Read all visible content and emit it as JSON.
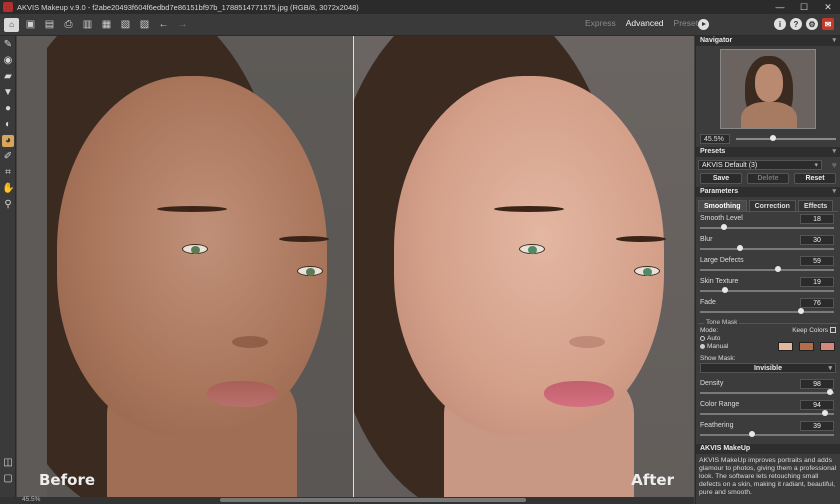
{
  "window": {
    "title": "AKVIS Makeup v.9.0 - f2abe20493f604f6edbd7e86151bf97b_1788514771575.jpg (RGB/8, 3072x2048)",
    "minimize": "—",
    "maximize": "☐",
    "close": "✕"
  },
  "toolbar": {
    "modes": [
      "Express",
      "Advanced",
      "Presets"
    ],
    "active_mode": "Advanced",
    "icons": [
      "home-icon",
      "open-icon",
      "save-icon",
      "print-icon",
      "batch-icon",
      "share-icon",
      "import-icon",
      "export-icon",
      "undo-icon",
      "redo-icon"
    ],
    "right_icons": [
      "info-icon",
      "help-icon",
      "settings-icon",
      "notifications-icon"
    ]
  },
  "canvas": {
    "before_label": "Before",
    "after_label": "After"
  },
  "status": {
    "zoom": "45.5%"
  },
  "navigator": {
    "title": "Navigator",
    "zoom": "45.5%"
  },
  "presets": {
    "title": "Presets",
    "selected": "AKVIS Default (3)",
    "save": "Save",
    "delete": "Delete",
    "reset": "Reset"
  },
  "parameters": {
    "title": "Parameters",
    "tabs": [
      "Smoothing",
      "Correction",
      "Effects"
    ],
    "sliders": [
      {
        "label": "Smooth Level",
        "value": 18,
        "fraction": 0.18
      },
      {
        "label": "Blur",
        "value": 30,
        "fraction": 0.3
      },
      {
        "label": "Large Defects",
        "value": 59,
        "fraction": 0.59
      },
      {
        "label": "Skin Texture",
        "value": 19,
        "fraction": 0.19
      },
      {
        "label": "Fade",
        "value": 76,
        "fraction": 0.76
      }
    ],
    "tone_mask": {
      "title": "Tone Mask",
      "mode_label": "Mode:",
      "keep_colors": "Keep Colors",
      "auto": "Auto",
      "manual": "Manual",
      "swatches": [
        "#e3b79c",
        "#b06e4a",
        "#d9867a"
      ]
    },
    "show_mask": {
      "label": "Show Mask:",
      "value": "Invisible"
    },
    "mask_sliders": [
      {
        "label": "Density",
        "value": 98,
        "fraction": 0.98
      },
      {
        "label": "Color Range",
        "value": 94,
        "fraction": 0.94
      },
      {
        "label": "Feathering",
        "value": 39,
        "fraction": 0.39
      }
    ]
  },
  "info": {
    "title": "AKVIS MakeUp",
    "text": "AKVIS MakeUp improves portraits and adds glamour to photos, giving them a professional look. The software lets retouching small defects on a skin, making it radiant, beautiful, pure and smooth."
  }
}
